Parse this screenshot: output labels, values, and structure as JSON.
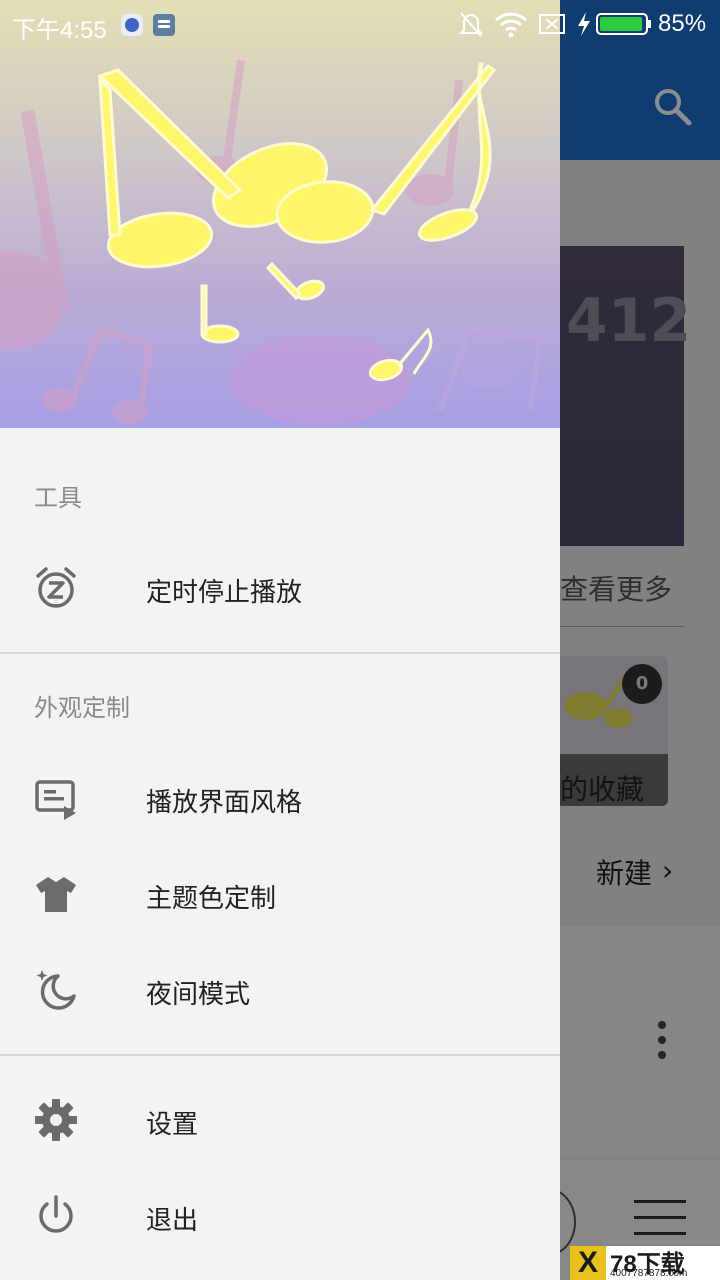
{
  "status_bar": {
    "time": "下午4:55",
    "battery": "85%",
    "battery_color": "#2ecc40"
  },
  "background": {
    "card_number": "412",
    "view_more": "查看更多",
    "favorites_count": "0",
    "favorites_label": "的收藏",
    "new_label": "新建",
    "accent_color": "#1d6fd0"
  },
  "drawer": {
    "sections": [
      {
        "title": "工具",
        "items": [
          {
            "label": "定时停止播放",
            "icon": "alarm-z-icon"
          }
        ]
      },
      {
        "title": "外观定制",
        "items": [
          {
            "label": "播放界面风格",
            "icon": "player-style-icon"
          },
          {
            "label": "主题色定制",
            "icon": "tshirt-icon"
          },
          {
            "label": "夜间模式",
            "icon": "moon-icon"
          }
        ]
      },
      {
        "title": "",
        "items": [
          {
            "label": "设置",
            "icon": "gear-icon"
          },
          {
            "label": "退出",
            "icon": "power-icon"
          }
        ]
      }
    ]
  },
  "watermark": {
    "logo_letter": "X",
    "title": "78下载",
    "sub": "4007787878.com"
  }
}
